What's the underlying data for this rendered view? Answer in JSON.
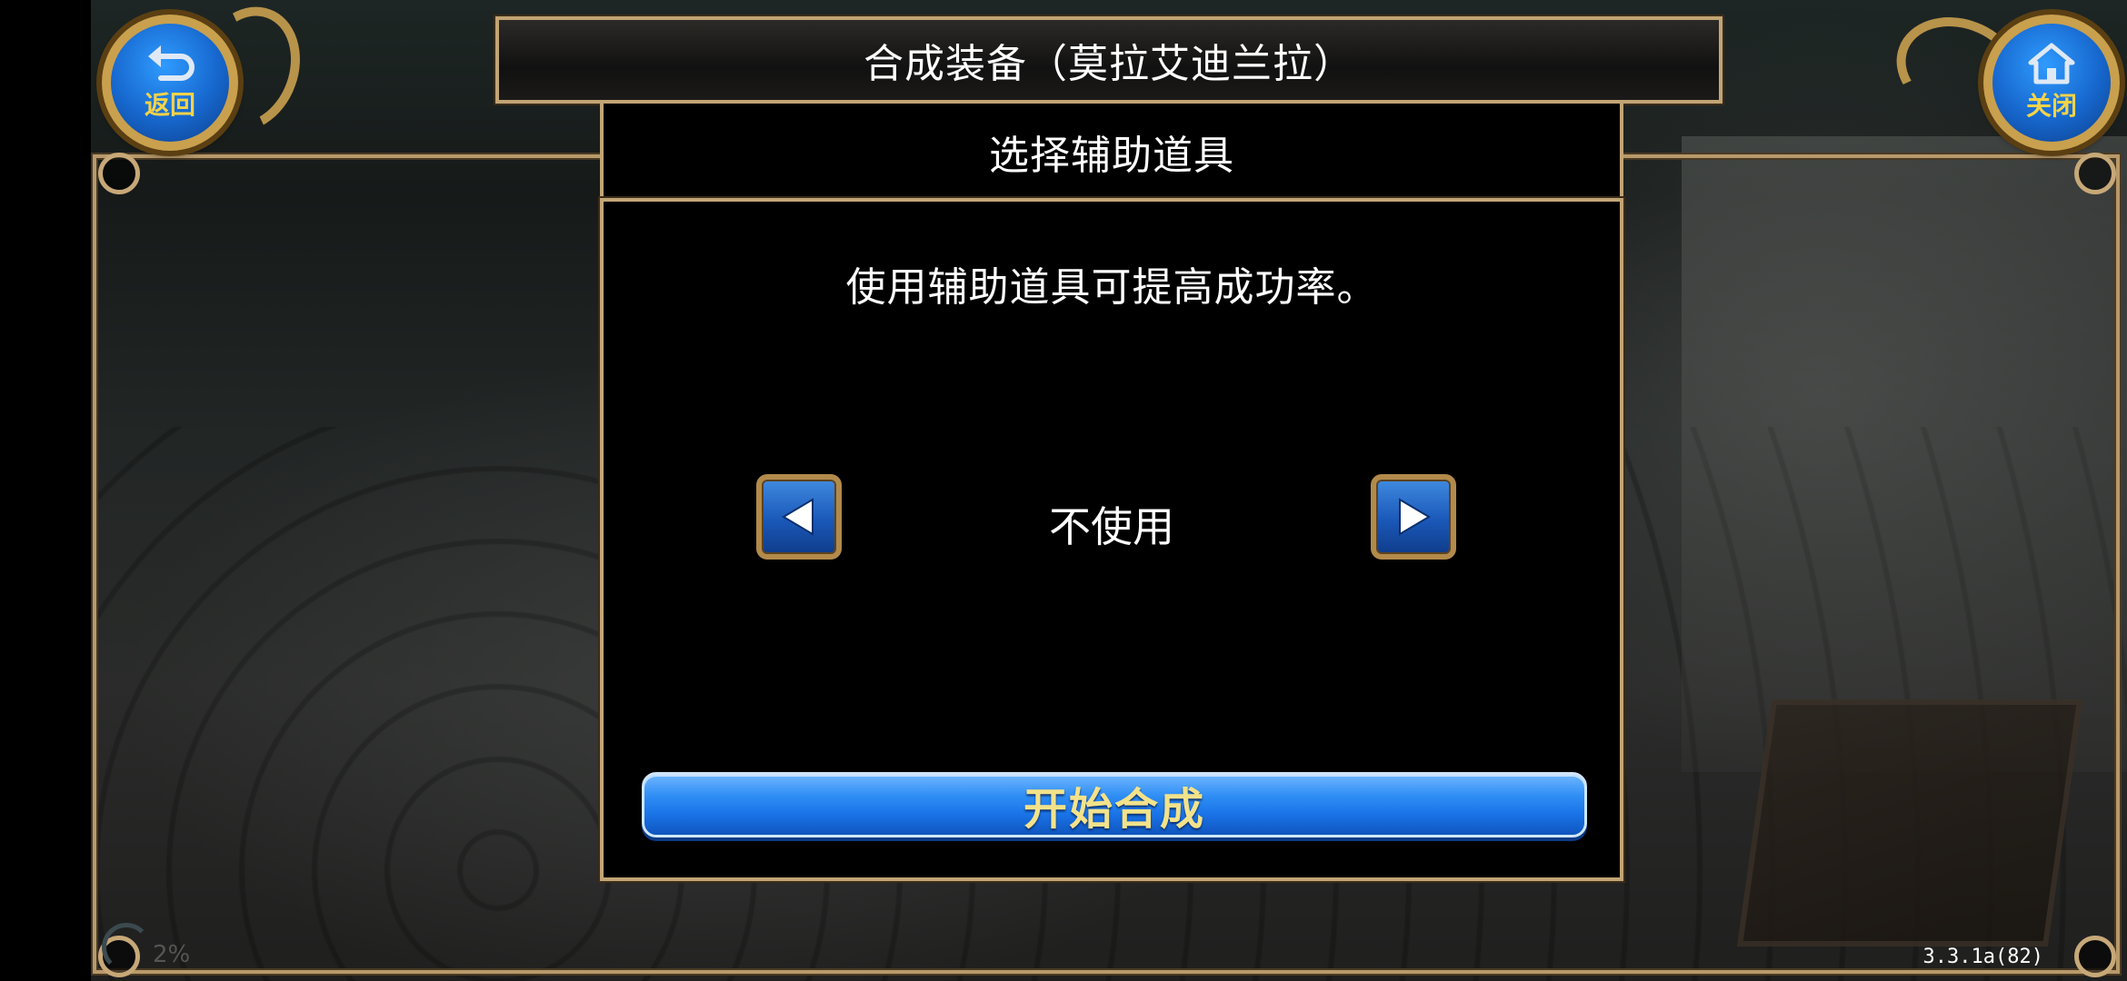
{
  "header": {
    "title": "合成装备（莫拉艾迪兰拉）",
    "back_label": "返回",
    "close_label": "关闭"
  },
  "dialog": {
    "title": "选择辅助道具",
    "hint": "使用辅助道具可提高成功率。",
    "selection": "不使用",
    "start_label": "开始合成"
  },
  "footer": {
    "signal": "2%",
    "version": "3.3.1a(82)"
  },
  "icons": {
    "back": "back-arrow-icon",
    "close": "home-icon",
    "prev": "left-triangle-icon",
    "next": "right-triangle-icon"
  },
  "colors": {
    "frame": "#c2a474",
    "button_blue": "#1a74e8",
    "button_text": "#f3e28a"
  }
}
